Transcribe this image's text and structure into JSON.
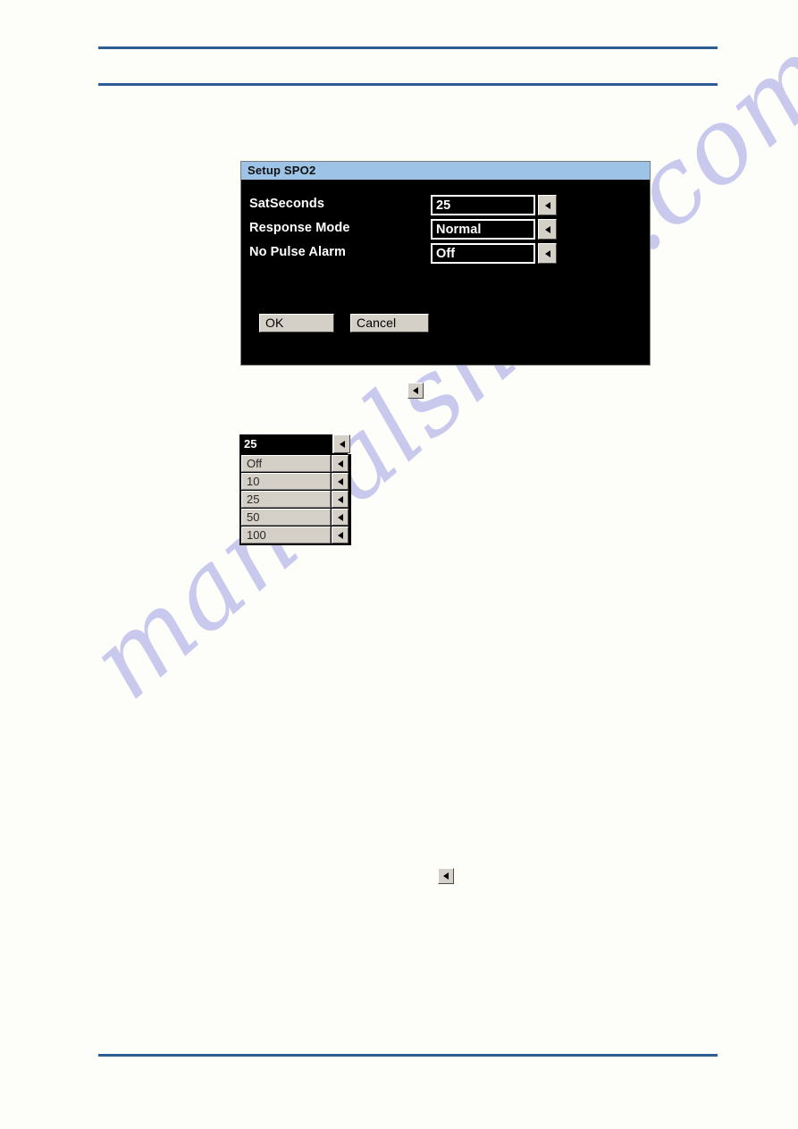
{
  "page": {
    "background_color": "#fdfdfa",
    "rule_color": "#2f5c94",
    "watermark_text": "manualshive.com",
    "watermark_color": "#c9c9ee"
  },
  "dialog": {
    "title": "Setup SPO2",
    "titlebar_color": "#9dc3e6",
    "background_color": "#000000",
    "fields": [
      {
        "label": "SatSeconds",
        "value": "25",
        "arrow_icon": "left-triangle-icon"
      },
      {
        "label": "Response Mode",
        "value": "Normal",
        "arrow_icon": "left-triangle-icon"
      },
      {
        "label": "No Pulse Alarm",
        "value": "Off",
        "arrow_icon": "left-triangle-icon"
      }
    ],
    "buttons": {
      "ok_label": "OK",
      "cancel_label": "Cancel"
    }
  },
  "callout_arrows": [
    {
      "icon": "left-triangle-icon"
    },
    {
      "icon": "left-triangle-icon"
    }
  ],
  "dropdown": {
    "selected_value": "25",
    "selected_arrow_icon": "left-triangle-icon",
    "options": [
      {
        "label": "Off",
        "arrow_icon": "left-triangle-icon"
      },
      {
        "label": "10",
        "arrow_icon": "left-triangle-icon"
      },
      {
        "label": "25",
        "arrow_icon": "left-triangle-icon"
      },
      {
        "label": "50",
        "arrow_icon": "left-triangle-icon"
      },
      {
        "label": "100",
        "arrow_icon": "left-triangle-icon"
      }
    ]
  }
}
